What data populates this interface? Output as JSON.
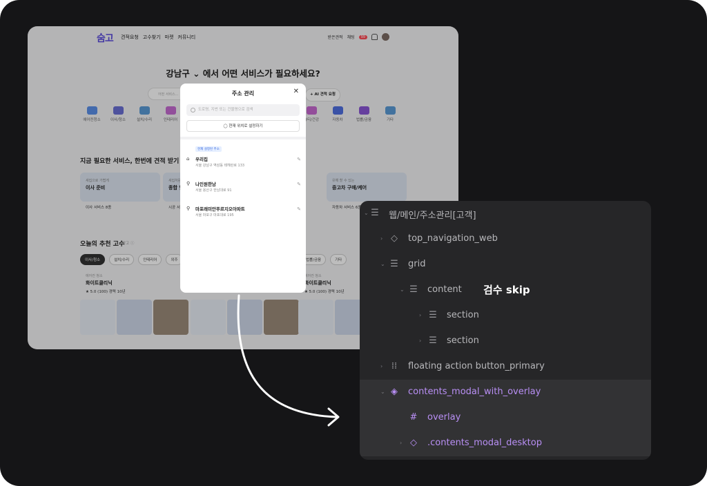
{
  "web": {
    "logo": "숨고",
    "nav": [
      "견적요청",
      "고수찾기",
      "마켓",
      "커뮤니티"
    ],
    "nav_right": {
      "received_quotes": "받은견적",
      "chat": "채팅",
      "chat_badge": "99"
    },
    "headline": "강남구 ⌄  에서 어떤 서비스가 필요하세요?",
    "search_placeholder": "어떤 서비스...",
    "ai_button": "+ AI 견적 요청",
    "categories_left": [
      "에어컨청소",
      "이사/청소",
      "설치/수리",
      "인테리어"
    ],
    "categories_right": [
      "뷰티/건강",
      "자동차",
      "법률/금융",
      "기타"
    ],
    "section_title": "지금 필요한 서비스, 한번에 견적 받기",
    "cards": [
      {
        "small": "새집으로 가볍게",
        "big": "이사 준비",
        "foot": "이사 서비스 8종"
      },
      {
        "small": "새집처럼",
        "big": "종합 인",
        "foot": "시공 서"
      },
      {
        "small": "유해 할 수 있는",
        "big": "중고차 구매/케어",
        "foot": "자동차 서비스 6종"
      }
    ],
    "recommend_title": "오늘의 추천 고수",
    "recommend_sub": "광고 ⓘ",
    "chips": [
      "이사/청소",
      "설치/수리",
      "인테리어",
      "외주",
      "법률/금융",
      "기타"
    ],
    "pros": [
      {
        "cat": "에어컨 청소",
        "name": "화이트클리닉",
        "rating": "★ 5.0 (100)   경력 10년"
      },
      {
        "cat": "에어컨 청소",
        "name": "화이트클리닉",
        "rating": "★ 5.0 (100)   경력 10년"
      }
    ]
  },
  "modal": {
    "title": "주소 관리",
    "close": "✕",
    "search_placeholder": "도로명, 지번 또는 건물명으로 검색",
    "current_location": "◯ 현재 위치로 설정하기",
    "current_tag": "현재 설정된 주소",
    "addresses": [
      {
        "name": "우리집",
        "address": "서울 강남구 역삼동 테헤란로 133",
        "icon": "home-icon"
      },
      {
        "name": "나인원한남",
        "address": "서울 용산구 한남대로 91",
        "icon": "map-pin-icon"
      },
      {
        "name": "마포래미안푸르지오아파트",
        "address": "서울 마포구 마포대로 195",
        "icon": "map-pin-icon"
      }
    ]
  },
  "layers": {
    "root": "웹/메인/주소관리[고객]",
    "items": [
      {
        "label": "top_navigation_web",
        "color": "gray"
      },
      {
        "label": "grid",
        "color": "gray"
      },
      {
        "label": "content",
        "color": "gray"
      },
      {
        "label": "section",
        "color": "gray"
      },
      {
        "label": "section",
        "color": "gray"
      },
      {
        "label": "floating action button_primary",
        "color": "gray"
      },
      {
        "label": "contents_modal_with_overlay",
        "color": "purple"
      },
      {
        "label": "overlay",
        "color": "purple"
      },
      {
        "label": ".contents_modal_desktop",
        "color": "purple"
      }
    ],
    "note": "검수 skip",
    "accent": "#b98ff5"
  }
}
